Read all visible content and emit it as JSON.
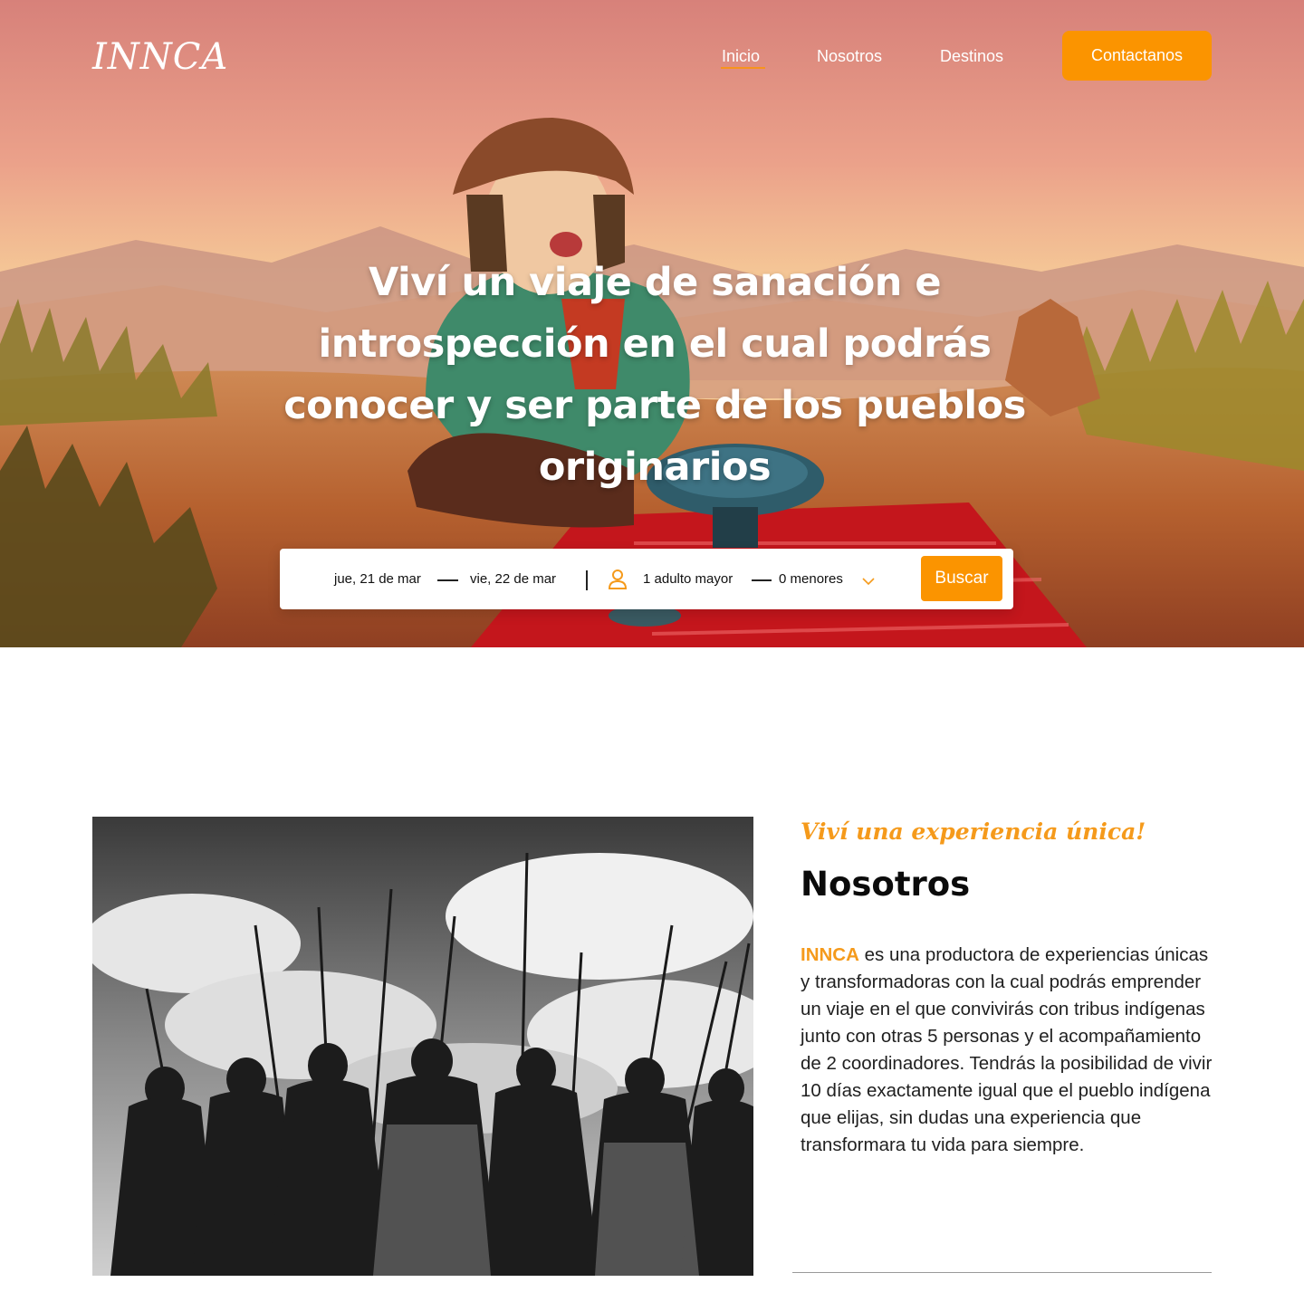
{
  "header": {
    "logo": "INNCA",
    "nav": [
      {
        "label": "Inicio",
        "active": true
      },
      {
        "label": "Nosotros",
        "active": false
      },
      {
        "label": "Destinos",
        "active": false
      }
    ],
    "cta_label": "Contactanos"
  },
  "hero": {
    "headline": "Viví un viaje de sanación e introspección en el cual podrás conocer y ser parte de los pueblos originarios"
  },
  "search": {
    "check_in": "jue, 21 de mar",
    "check_out": "vie, 22 de mar",
    "adults": "1 adulto mayor",
    "minors": "0 menores",
    "button_label": "Buscar",
    "icons": [
      "calendar-icon",
      "person-icon",
      "chevron-down-icon"
    ]
  },
  "about": {
    "tagline": "Viví una experiencia única!",
    "title": "Nosotros",
    "brand": "INNCA",
    "body": " es una productora de experiencias únicas y transformadoras con la cual podrás emprender un viaje en el que convivirás con tribus indígenas junto con otras 5 personas y el acompañamiento de 2 coordinadores. Tendrás la posibilidad de vivir 10 días exactamente igual que el pueblo indígena que elijas, sin dudas una experiencia que transformara tu vida para siempre."
  },
  "colors": {
    "accent": "#fb9400",
    "tagline": "#f59a1b",
    "text": "#1f1f1f"
  }
}
